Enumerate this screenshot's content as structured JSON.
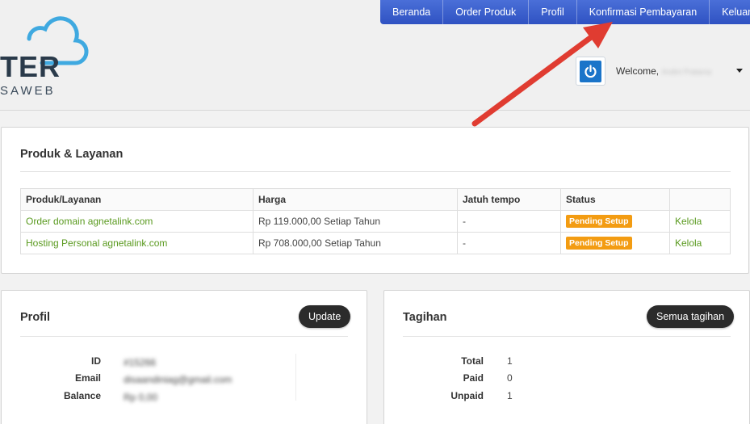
{
  "logo": {
    "text": "TER",
    "subtext": "SAWEB"
  },
  "nav": {
    "items": [
      {
        "label": "Beranda"
      },
      {
        "label": "Order Produk"
      },
      {
        "label": "Profil"
      },
      {
        "label": "Konfirmasi Pembayaran"
      },
      {
        "label": "Keluar"
      }
    ]
  },
  "user": {
    "welcome": "Welcome,",
    "name": "Andini Pratama"
  },
  "products": {
    "title": "Produk & Layanan",
    "columns": [
      "Produk/Layanan",
      "Harga",
      "Jatuh tempo",
      "Status",
      ""
    ],
    "rows": [
      {
        "name": "Order domain agnetalink.com",
        "price": "Rp 119.000,00 Setiap Tahun",
        "due": "-",
        "status": "Pending Setup",
        "action": "Kelola"
      },
      {
        "name": "Hosting Personal agnetalink.com",
        "price": "Rp 708.000,00 Setiap Tahun",
        "due": "-",
        "status": "Pending Setup",
        "action": "Kelola"
      }
    ]
  },
  "profile": {
    "title": "Profil",
    "button": "Update",
    "labels": {
      "id": "ID",
      "email": "Email",
      "balance": "Balance"
    },
    "values": {
      "id": "#15266",
      "email": "disaandiniag@gmail.com",
      "balance": "Rp 0,00"
    }
  },
  "billing": {
    "title": "Tagihan",
    "button": "Semua tagihan",
    "labels": {
      "total": "Total",
      "paid": "Paid",
      "unpaid": "Unpaid"
    },
    "values": {
      "total": "1",
      "paid": "0",
      "unpaid": "1"
    }
  },
  "colors": {
    "nav": "#3a5fcf",
    "link": "#5a9a1f",
    "badge": "#f39c12",
    "arrow": "#e03c31",
    "power": "#1a74c9"
  }
}
